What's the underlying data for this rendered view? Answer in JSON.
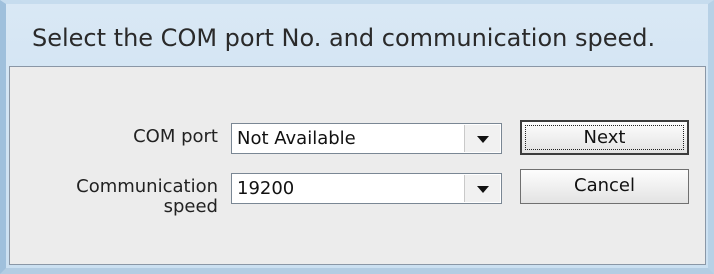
{
  "dialog": {
    "title": "Select the COM port No. and communication speed."
  },
  "form": {
    "com_port_label": "COM port",
    "com_port_value": "Not Available",
    "speed_label": "Communication speed",
    "speed_value": "19200"
  },
  "buttons": {
    "next_label": "Next",
    "cancel_label": "Cancel"
  }
}
